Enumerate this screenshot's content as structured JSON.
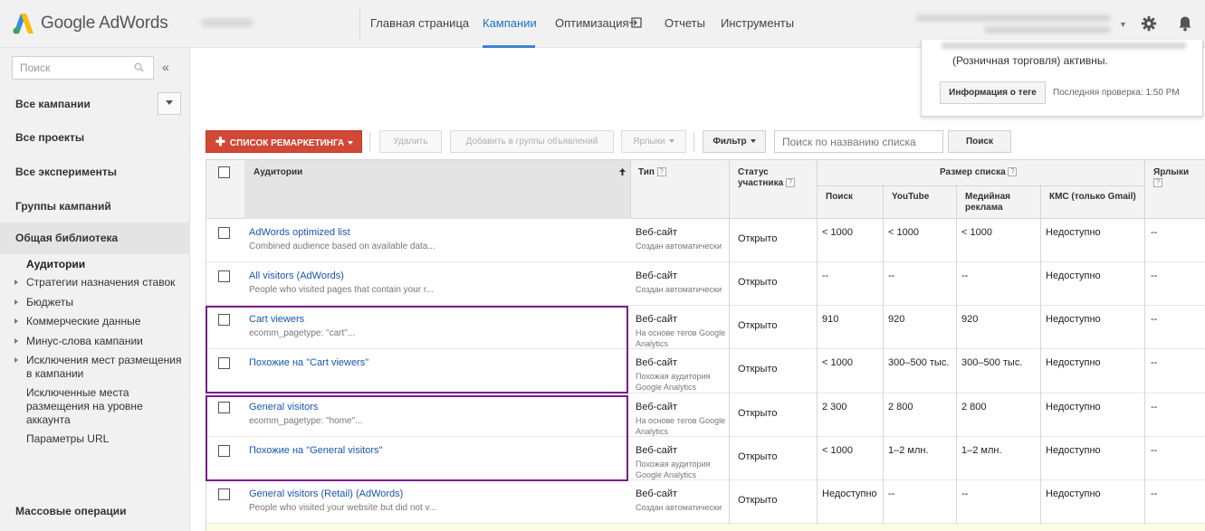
{
  "header": {
    "brand": "Google AdWords",
    "nav": [
      "Главная страница",
      "Кампании",
      "Оптимизация",
      "Отчеты",
      "Инструменты"
    ],
    "active_nav": "Кампании"
  },
  "sidebar": {
    "search_placeholder": "Поиск",
    "collapse": "«",
    "items": [
      "Все кампании",
      "Все проекты",
      "Все эксперименты",
      "Группы кампаний",
      "Общая библиотека"
    ],
    "library": {
      "active": "Аудитории",
      "items": [
        "Стратегии назначения ставок",
        "Бюджеты",
        "Коммерческие данные",
        "Минус-слова кампании",
        "Исключения мест размещения в кампании",
        "Исключенные места размещения на уровне аккаунта",
        "Параметры URL"
      ]
    },
    "bottom": "Массовые операции"
  },
  "info": {
    "text": "(Розничная торговля) активны.",
    "tag_button": "Информация о теге",
    "last_check": "Последняя проверка: 1:50 PM"
  },
  "toolbar": {
    "remarketing": "СПИСОК РЕМАРКЕТИНГА",
    "delete": "Удалить",
    "add_to_groups": "Добавить в группы объявлений",
    "labels": "Ярлыки",
    "filter": "Фильтр",
    "search_placeholder": "Поиск по названию списка",
    "search": "Поиск"
  },
  "table": {
    "headers": {
      "audiences": "Аудитории",
      "type": "Тип",
      "status": "Статус участника",
      "size": "Размер списка",
      "search": "Поиск",
      "youtube": "YouTube",
      "display": "Медийная реклама",
      "gmail": "КМС (только Gmail)",
      "labels": "Ярлыки"
    },
    "rows": [
      {
        "name": "AdWords optimized list",
        "desc": "Combined audience based on available data...",
        "type": "Веб-сайт",
        "type_sub": "Создан автоматически",
        "status": "Открыто",
        "search": "< 1000",
        "youtube": "< 1000",
        "display": "< 1000",
        "gmail": "Недоступно",
        "labels": "--"
      },
      {
        "name": "All visitors (AdWords)",
        "desc": "People who visited pages that contain your r...",
        "type": "Веб-сайт",
        "type_sub": "Создан автоматически",
        "status": "Открыто",
        "search": "--",
        "youtube": "--",
        "display": "--",
        "gmail": "Недоступно",
        "labels": "--"
      },
      {
        "name": "Cart viewers",
        "desc": "ecomm_pagetype: \"cart\"...",
        "type": "Веб-сайт",
        "type_sub": "На основе тегов Google Analytics",
        "status": "Открыто",
        "search": "910",
        "youtube": "920",
        "display": "920",
        "gmail": "Недоступно",
        "labels": "--"
      },
      {
        "name": "Похожие на \"Cart viewers\"",
        "desc": "",
        "type": "Веб-сайт",
        "type_sub": "Похожая аудитория Google Analytics",
        "status": "Открыто",
        "search": "< 1000",
        "youtube": "300–500 тыс.",
        "display": "300–500 тыс.",
        "gmail": "Недоступно",
        "labels": "--"
      },
      {
        "name": "General visitors",
        "desc": "ecomm_pagetype: \"home\"...",
        "type": "Веб-сайт",
        "type_sub": "На основе тегов Google Analytics",
        "status": "Открыто",
        "search": "2 300",
        "youtube": "2 800",
        "display": "2 800",
        "gmail": "Недоступно",
        "labels": "--"
      },
      {
        "name": "Похожие на \"General visitors\"",
        "desc": "",
        "type": "Веб-сайт",
        "type_sub": "Похожая аудитория Google Analytics",
        "status": "Открыто",
        "search": "< 1000",
        "youtube": "1–2 млн.",
        "display": "1–2 млн.",
        "gmail": "Недоступно",
        "labels": "--"
      },
      {
        "name": "General visitors (Retail) (AdWords)",
        "desc": "People who visited your website but did not v...",
        "type": "Веб-сайт",
        "type_sub": "Создан автоматически",
        "status": "Открыто",
        "search": "Недоступно",
        "youtube": "--",
        "display": "--",
        "gmail": "Недоступно",
        "labels": "--"
      }
    ]
  },
  "colors": {
    "accent": "#1a73c8",
    "remarketing_button": "#d14836",
    "highlight": "#7a1c8c",
    "link": "#1a55b0"
  }
}
